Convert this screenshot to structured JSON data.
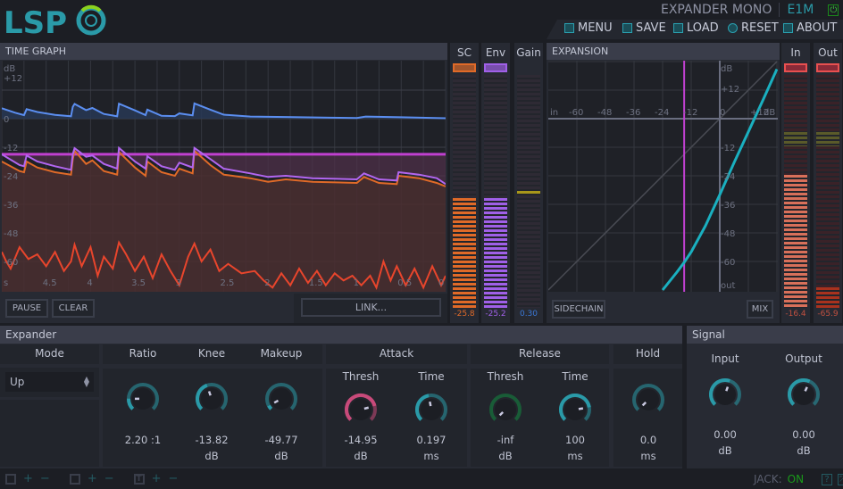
{
  "header": {
    "logo": "LSP",
    "plugin_name": "EXPANDER MONO",
    "plugin_code": "E1M",
    "power_icon": "power-icon",
    "menu": [
      {
        "label": "MENU",
        "icon": "menu-icon"
      },
      {
        "label": "SAVE",
        "icon": "save-icon"
      },
      {
        "label": "LOAD",
        "icon": "load-icon"
      },
      {
        "label": "RESET",
        "icon": "reset-icon"
      },
      {
        "label": "ABOUT",
        "icon": "about-icon"
      }
    ]
  },
  "time_graph": {
    "title": "TIME GRAPH",
    "db_unit": "dB",
    "db_labels": [
      "+12",
      "0",
      "-12",
      "-24",
      "-36",
      "-48",
      "-60"
    ],
    "time_unit": "s",
    "time_labels": [
      "4.5",
      "4",
      "3.5",
      "3",
      "2.5",
      "2",
      "1.5",
      "1",
      "0.5",
      "0"
    ],
    "pause_label": "PAUSE",
    "clear_label": "CLEAR",
    "link_label": "LINK...",
    "colors": {
      "gain": "#5b8ef0",
      "envelope": "#b266f0",
      "sidechain": "#e06a28",
      "input": "#e8452c",
      "threshold": "#c040d0"
    },
    "threshold_db": -14.95,
    "gain": [
      [
        5,
        4.4
      ],
      [
        4.85,
        2.5
      ],
      [
        4.75,
        1.5
      ],
      [
        4.72,
        4
      ],
      [
        4.6,
        2.8
      ],
      [
        4.4,
        1.6
      ],
      [
        4.22,
        1
      ],
      [
        4.2,
        5
      ],
      [
        4.18,
        6.2
      ],
      [
        4.05,
        3.6
      ],
      [
        3.98,
        4.5
      ],
      [
        3.85,
        2
      ],
      [
        3.7,
        1
      ],
      [
        3.68,
        6.3
      ],
      [
        3.5,
        3.5
      ],
      [
        3.38,
        1.5
      ],
      [
        3.36,
        3.8
      ],
      [
        3.2,
        1.2
      ],
      [
        3.05,
        1.1
      ],
      [
        3.0,
        2.2
      ],
      [
        2.85,
        1.4
      ],
      [
        2.83,
        6.4
      ],
      [
        2.65,
        3.8
      ],
      [
        2.5,
        1.7
      ],
      [
        2.2,
        0.9
      ],
      [
        1.8,
        0.7
      ],
      [
        1.3,
        0.4
      ],
      [
        1.0,
        0.3
      ],
      [
        0.9,
        0.9
      ],
      [
        0.5,
        0.6
      ],
      [
        0,
        0.2
      ]
    ],
    "envelope": [
      [
        5,
        -15
      ],
      [
        4.8,
        -19.5
      ],
      [
        4.75,
        -20
      ],
      [
        4.72,
        -15.5
      ],
      [
        4.6,
        -18
      ],
      [
        4.4,
        -20
      ],
      [
        4.22,
        -21.5
      ],
      [
        4.2,
        -15
      ],
      [
        4.18,
        -12.4
      ],
      [
        4.05,
        -16
      ],
      [
        3.98,
        -15.5
      ],
      [
        3.85,
        -19
      ],
      [
        3.7,
        -21
      ],
      [
        3.68,
        -12.3
      ],
      [
        3.5,
        -18
      ],
      [
        3.38,
        -21
      ],
      [
        3.36,
        -15.8
      ],
      [
        3.2,
        -20
      ],
      [
        3.05,
        -21.5
      ],
      [
        3.0,
        -18.5
      ],
      [
        2.85,
        -20.5
      ],
      [
        2.83,
        -12.3
      ],
      [
        2.65,
        -17
      ],
      [
        2.5,
        -21
      ],
      [
        2.2,
        -23
      ],
      [
        2.0,
        -24.5
      ],
      [
        1.8,
        -24
      ],
      [
        1.5,
        -25
      ],
      [
        1.0,
        -25.5
      ],
      [
        0.92,
        -23
      ],
      [
        0.75,
        -25.5
      ],
      [
        0.55,
        -26
      ],
      [
        0.53,
        -22.5
      ],
      [
        0.3,
        -23.5
      ],
      [
        0.1,
        -25
      ],
      [
        0,
        -27.5
      ]
    ],
    "sidechain": [
      [
        5,
        -18
      ],
      [
        4.8,
        -22
      ],
      [
        4.75,
        -22.5
      ],
      [
        4.72,
        -18
      ],
      [
        4.6,
        -20.5
      ],
      [
        4.4,
        -22.5
      ],
      [
        4.22,
        -23.5
      ],
      [
        4.2,
        -17
      ],
      [
        4.18,
        -13.5
      ],
      [
        4.05,
        -19
      ],
      [
        3.98,
        -17.5
      ],
      [
        3.85,
        -22
      ],
      [
        3.7,
        -23.5
      ],
      [
        3.68,
        -14
      ],
      [
        3.5,
        -20.5
      ],
      [
        3.38,
        -24
      ],
      [
        3.36,
        -18
      ],
      [
        3.2,
        -22.5
      ],
      [
        3.05,
        -24
      ],
      [
        3.0,
        -21
      ],
      [
        2.85,
        -23
      ],
      [
        2.83,
        -13.5
      ],
      [
        2.65,
        -19.5
      ],
      [
        2.5,
        -23.5
      ],
      [
        2.2,
        -25
      ],
      [
        2.0,
        -26.5
      ],
      [
        1.8,
        -25.5
      ],
      [
        1.5,
        -26.5
      ],
      [
        1.0,
        -27
      ],
      [
        0.92,
        -24.5
      ],
      [
        0.75,
        -27
      ],
      [
        0.55,
        -27.5
      ],
      [
        0.53,
        -24
      ],
      [
        0.3,
        -25
      ],
      [
        0.1,
        -27
      ],
      [
        0,
        -28.5
      ]
    ],
    "input": [
      [
        5,
        -56
      ],
      [
        4.95,
        -60
      ],
      [
        4.9,
        -63
      ],
      [
        4.8,
        -54
      ],
      [
        4.7,
        -59
      ],
      [
        4.6,
        -57
      ],
      [
        4.5,
        -62
      ],
      [
        4.4,
        -56
      ],
      [
        4.3,
        -64
      ],
      [
        4.22,
        -60
      ],
      [
        4.18,
        -53
      ],
      [
        4.1,
        -62
      ],
      [
        4.0,
        -54
      ],
      [
        3.92,
        -66
      ],
      [
        3.85,
        -58
      ],
      [
        3.75,
        -63
      ],
      [
        3.68,
        -52
      ],
      [
        3.6,
        -57
      ],
      [
        3.5,
        -64
      ],
      [
        3.4,
        -58
      ],
      [
        3.3,
        -67
      ],
      [
        3.2,
        -57
      ],
      [
        3.1,
        -64
      ],
      [
        3.0,
        -70
      ],
      [
        2.9,
        -58
      ],
      [
        2.83,
        -52.5
      ],
      [
        2.75,
        -60
      ],
      [
        2.65,
        -55
      ],
      [
        2.55,
        -64
      ],
      [
        2.45,
        -61
      ],
      [
        2.3,
        -65
      ],
      [
        2.15,
        -64
      ],
      [
        2.05,
        -68
      ],
      [
        1.95,
        -71
      ],
      [
        1.85,
        -65
      ],
      [
        1.75,
        -70
      ],
      [
        1.65,
        -63
      ],
      [
        1.55,
        -69
      ],
      [
        1.45,
        -64
      ],
      [
        1.35,
        -70
      ],
      [
        1.25,
        -65
      ],
      [
        1.15,
        -68
      ],
      [
        1.05,
        -66
      ],
      [
        0.95,
        -70
      ],
      [
        0.85,
        -66
      ],
      [
        0.78,
        -71
      ],
      [
        0.7,
        -60
      ],
      [
        0.62,
        -68
      ],
      [
        0.55,
        -62
      ],
      [
        0.45,
        -70
      ],
      [
        0.35,
        -63
      ],
      [
        0.25,
        -71
      ],
      [
        0.15,
        -62
      ],
      [
        0.05,
        -70
      ],
      [
        0,
        -66
      ]
    ]
  },
  "meters": [
    {
      "label": "SC",
      "value": "-25.8",
      "level": 0.47,
      "color": "#e06a28"
    },
    {
      "label": "Env",
      "value": "-25.2",
      "level": 0.47,
      "color": "#a060e8"
    },
    {
      "label": "Gain",
      "value": "0.30",
      "level": 0.49,
      "color": "#3a78d8"
    }
  ],
  "expansion": {
    "title": "EXPANSION",
    "in_label": "in",
    "out_label": "out",
    "db_unit": "dB",
    "in_ticks": [
      "-60",
      "-48",
      "-36",
      "-24",
      "-12",
      "0",
      "+12"
    ],
    "out_ticks": [
      "+12",
      "-12",
      "-24",
      "-36",
      "-48",
      "-60"
    ],
    "curve_color": "#1ab0c0",
    "threshold_db": -14.95,
    "curve": [
      [
        -24,
        -72
      ],
      [
        -18,
        -64.5
      ],
      [
        -15,
        -60.5
      ],
      [
        -12,
        -56
      ],
      [
        -6,
        -45
      ],
      [
        0,
        -32
      ],
      [
        6,
        -18.5
      ],
      [
        12,
        -5.5
      ],
      [
        18,
        7.5
      ],
      [
        24,
        20.8
      ]
    ],
    "sidechain_label": "SIDECHAIN",
    "mix_label": "MIX"
  },
  "io_meters": [
    {
      "label": "In",
      "value": "-16.4",
      "level": 0.57
    },
    {
      "label": "Out",
      "value": "-65.9",
      "level": 0.09
    }
  ],
  "expander": {
    "title": "Expander",
    "mode_label": "Mode",
    "mode_value": "Up",
    "ratio_label": "Ratio",
    "knee_label": "Knee",
    "makeup_label": "Makeup",
    "attack_label": "Attack",
    "release_label": "Release",
    "hold_label": "Hold",
    "thresh_label": "Thresh",
    "time_label": "Time",
    "knobs": [
      {
        "id": "ratio",
        "value": "2.20 :1",
        "unit": "",
        "level": 0.17,
        "color": "#2a9aa8"
      },
      {
        "id": "knee",
        "value": "-13.82",
        "unit": "dB",
        "level": 0.43,
        "color": "#2a9aa8"
      },
      {
        "id": "makeup",
        "value": "-49.77",
        "unit": "dB",
        "level": 0.06,
        "color": "#2a9aa8"
      },
      {
        "id": "attack-thresh",
        "value": "-14.95",
        "unit": "dB",
        "level": 0.78,
        "color": "#c84a7a"
      },
      {
        "id": "attack-time",
        "value": "0.197",
        "unit": "ms",
        "level": 0.46,
        "color": "#2a9aa8"
      },
      {
        "id": "release-thresh",
        "value": "-inf",
        "unit": "dB",
        "level": 0.0,
        "color": "#138a42"
      },
      {
        "id": "release-time",
        "value": "100",
        "unit": "ms",
        "level": 0.8,
        "color": "#2a9aa8"
      },
      {
        "id": "hold",
        "value": "0.0",
        "unit": "ms",
        "level": 0.0,
        "color": "#2a9aa8"
      }
    ]
  },
  "signal": {
    "title": "Signal",
    "input_label": "Input",
    "output_label": "Output",
    "knobs": [
      {
        "id": "input",
        "value": "0.00",
        "unit": "dB",
        "level": 0.57,
        "color": "#2a9aa8"
      },
      {
        "id": "output",
        "value": "0.00",
        "unit": "dB",
        "level": 0.59,
        "color": "#2a9aa8"
      }
    ]
  },
  "footer": {
    "jack_label": "JACK:",
    "jack_status": "ON",
    "help_icon": "help-icon",
    "fullscreen_icon": "fullscreen-icon"
  }
}
